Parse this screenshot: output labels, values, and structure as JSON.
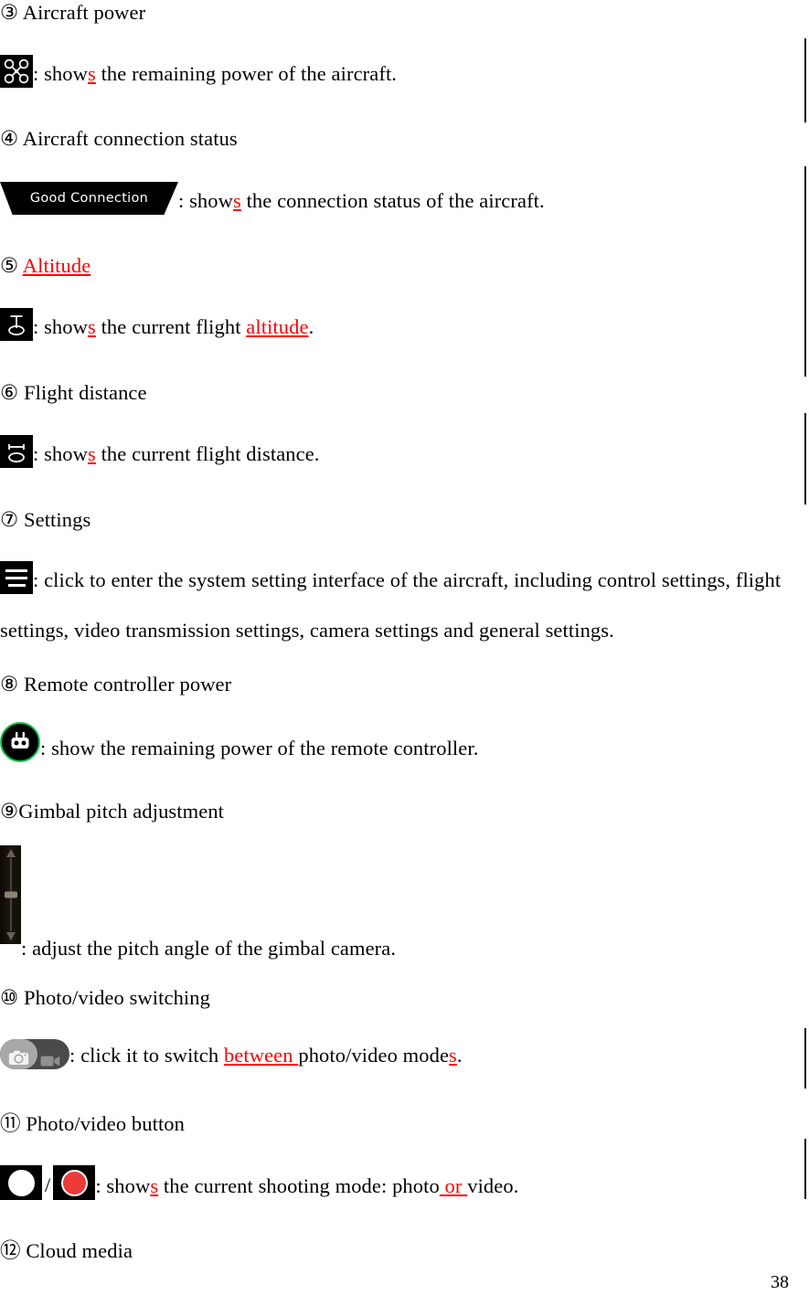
{
  "page": {
    "number": "38"
  },
  "sections": [
    {
      "heading": "③ Aircraft power",
      "icon": "drone-icon",
      "desc_pre": ": show",
      "desc_ins": "s",
      "desc_post": " the remaining power of the aircraft."
    },
    {
      "heading": "④ Aircraft connection status",
      "icon": "good-connection-badge",
      "badge_label": "Good Connection",
      "desc_pre": " : show",
      "desc_ins": "s",
      "desc_post": " the connection status of the aircraft."
    },
    {
      "heading_prefix": "⑤ ",
      "heading_ins": "Altitude",
      "icon": "altitude-icon",
      "desc_pre": ": show",
      "desc_ins": "s",
      "desc_mid": " the current flight ",
      "desc_ins2": "altitude",
      "desc_post": "."
    },
    {
      "heading": "⑥ Flight distance",
      "icon": "distance-icon",
      "desc_pre": ": show",
      "desc_ins": "s",
      "desc_post": " the current flight distance."
    },
    {
      "heading": "⑦ Settings",
      "icon": "menu-icon",
      "desc_line1": ": click to enter the system setting interface of the aircraft, including control settings, flight",
      "desc_line2": "settings, video transmission settings, camera settings and general settings."
    },
    {
      "heading": "⑧ Remote controller power",
      "icon": "remote-controller-icon",
      "desc": ": show the remaining power of the remote controller."
    },
    {
      "heading": "⑨Gimbal pitch adjustment",
      "icon": "gimbal-pitch-slider",
      "desc": ": adjust the pitch angle of the gimbal camera."
    },
    {
      "heading": "⑩ Photo/video switching",
      "icon": "photo-video-toggle",
      "desc_pre": ": click it to switch ",
      "desc_ins": "between ",
      "desc_mid": "photo/video mode",
      "desc_ins2": "s",
      "desc_post": "."
    },
    {
      "heading": "⑪ Photo/video button",
      "icon": "shutter-buttons",
      "separator": "/",
      "desc_pre": ": show",
      "desc_ins": "s",
      "desc_mid": " the current shooting mode: photo",
      "desc_ins2": " or ",
      "desc_post": "video."
    },
    {
      "heading": "⑫ Cloud media"
    }
  ],
  "colors": {
    "insertion": "#ff0000",
    "text": "#000000",
    "badge_bg": "#000000",
    "rc_ring": "#14c24a",
    "video_red": "#ef3a3a"
  }
}
